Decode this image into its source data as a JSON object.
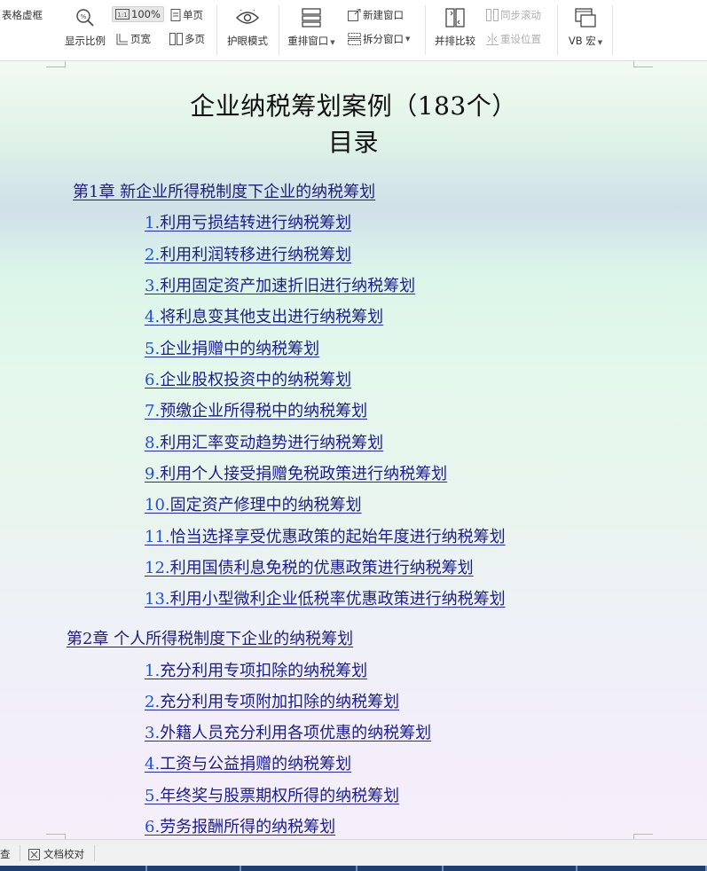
{
  "toolbar": {
    "grid_lines": "表格虚框",
    "zoom_ratio": "显示比例",
    "zoom_value": "100%",
    "single_page": "单页",
    "page_width": "页宽",
    "multi_page": "多页",
    "eye_mode": "护眼模式",
    "rearrange_window": "重排窗口",
    "new_window": "新建窗口",
    "split_window": "拆分窗口",
    "side_by_side": "并排比较",
    "sync_scroll": "同步滚动",
    "reset_position": "重设位置",
    "vb_macro": "VB 宏"
  },
  "document": {
    "title": "企业纳税筹划案例（183个）",
    "subtitle": "目录",
    "chapters": [
      {
        "heading": "第1章  新企业所得税制度下企业的纳税筹划",
        "items": [
          {
            "num": "1.",
            "text": "利用亏损结转进行纳税筹划"
          },
          {
            "num": "2.",
            "text": "利用利润转移进行纳税筹划"
          },
          {
            "num": "3.",
            "text": "利用固定资产加速折旧进行纳税筹划"
          },
          {
            "num": "4.",
            "text": "将利息变其他支出进行纳税筹划"
          },
          {
            "num": "5.",
            "text": "企业捐赠中的纳税筹划"
          },
          {
            "num": "6.",
            "text": "企业股权投资中的纳税筹划"
          },
          {
            "num": "7.",
            "text": "预缴企业所得税中的纳税筹划"
          },
          {
            "num": "8.",
            "text": "利用汇率变动趋势进行纳税筹划"
          },
          {
            "num": "9.",
            "text": "利用个人接受捐赠免税政策进行纳税筹划"
          },
          {
            "num": "10.",
            "text": "固定资产修理中的纳税筹划"
          },
          {
            "num": "11.",
            "text": "恰当选择享受优惠政策的起始年度进行纳税筹划"
          },
          {
            "num": "12.",
            "text": "利用国债利息免税的优惠政策进行纳税筹划"
          },
          {
            "num": "13.",
            "text": "利用小型微利企业低税率优惠政策进行纳税筹划"
          }
        ]
      },
      {
        "heading": "第2章  个人所得税制度下企业的纳税筹划",
        "items": [
          {
            "num": "1.",
            "text": "充分利用专项扣除的纳税筹划"
          },
          {
            "num": "2.",
            "text": "充分利用专项附加扣除的纳税筹划"
          },
          {
            "num": "3.",
            "text": "外籍人员充分利用各项优惠的纳税筹划"
          },
          {
            "num": "4.",
            "text": "工资与公益捐赠的纳税筹划"
          },
          {
            "num": "5.",
            "text": "年终奖与股票期权所得的纳税筹划"
          },
          {
            "num": "6.",
            "text": "劳务报酬所得的纳税筹划"
          }
        ]
      }
    ]
  },
  "statusbar": {
    "left_fragment": "查",
    "proofread": "文档校对"
  },
  "colors": {
    "link_text": "#1c1c8c",
    "link_number": "#1f4fd8",
    "chapter_text": "#1f1f7a"
  }
}
